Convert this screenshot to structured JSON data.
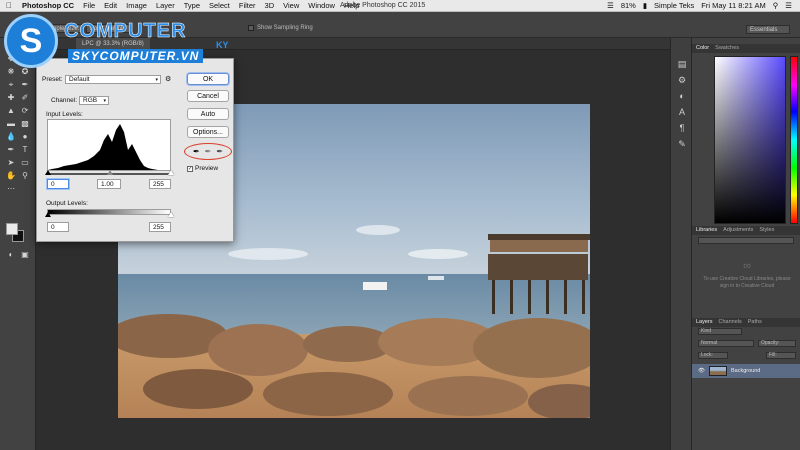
{
  "menubar": {
    "app_name": "Photoshop CC",
    "items": [
      "File",
      "Edit",
      "Image",
      "Layer",
      "Type",
      "Select",
      "Filter",
      "3D",
      "View",
      "Window",
      "Help"
    ],
    "document_title": "Adobe Photoshop CC 2015",
    "battery": "81%",
    "user": "Simple Teks",
    "datetime": "Fri May 11  8:21 AM"
  },
  "options_bar": {
    "sample_size": "Sample Size:",
    "point_sample": "Point Sample",
    "show_sampling_ring": "Show Sampling Ring",
    "workspace": "Essentials"
  },
  "document_tab": {
    "label": "LPC @ 33.3% (RGB/8)"
  },
  "levels": {
    "preset_label": "Preset:",
    "preset_value": "Default",
    "channel_label": "Channel:",
    "channel_value": "RGB",
    "input_levels_label": "Input Levels:",
    "input_black": "0",
    "input_gamma": "1.00",
    "input_white": "255",
    "output_levels_label": "Output Levels:",
    "output_black": "0",
    "output_white": "255",
    "ok_label": "OK",
    "cancel_label": "Cancel",
    "auto_label": "Auto",
    "options_label": "Options...",
    "preview_label": "Preview",
    "preview_checked": true
  },
  "right_panel": {
    "color_tabs": [
      "Color",
      "Swatches"
    ],
    "library_tabs": [
      "Libraries",
      "Adjustments",
      "Styles"
    ],
    "cc_message": "To use Creative Cloud Libraries, please sign in to Creative Cloud",
    "layer_tabs": [
      "Layers",
      "Channels",
      "Paths"
    ],
    "kind_label": "Kind",
    "blend_mode": "Normal",
    "opacity_label": "Opacity:",
    "lock_label": "Lock:",
    "fill_label": "Fill:",
    "layer_name": "Background"
  },
  "watermark": {
    "line1": "COMPUTER",
    "line2": "SKYCOMPUTER.VN",
    "line3": "KY"
  },
  "colors": {
    "accent_highlight": "#d9412c",
    "selected_layer": "#5b6a85",
    "watermark_blue": "#1d7fd8"
  }
}
